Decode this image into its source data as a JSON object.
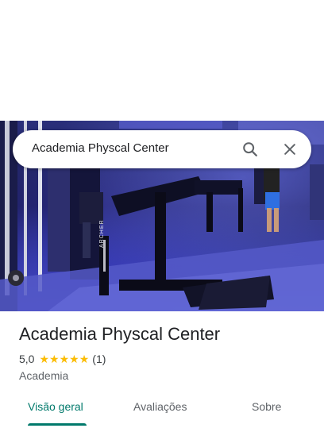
{
  "search": {
    "query": "Academia Physcal Center"
  },
  "place": {
    "name": "Academia Physcal Center",
    "rating": "5,0",
    "stars": 5,
    "review_count": "(1)",
    "category": "Academia"
  },
  "tabs": [
    {
      "label": "Visão geral",
      "active": true
    },
    {
      "label": "Avaliações",
      "active": false
    },
    {
      "label": "Sobre",
      "active": false
    }
  ],
  "photo": {
    "machine_brand": "ARCHER"
  },
  "colors": {
    "accent": "#00796b",
    "star": "#fbbc04"
  },
  "icons": {
    "search": "search-icon",
    "close": "close-icon",
    "star": "star-icon"
  }
}
